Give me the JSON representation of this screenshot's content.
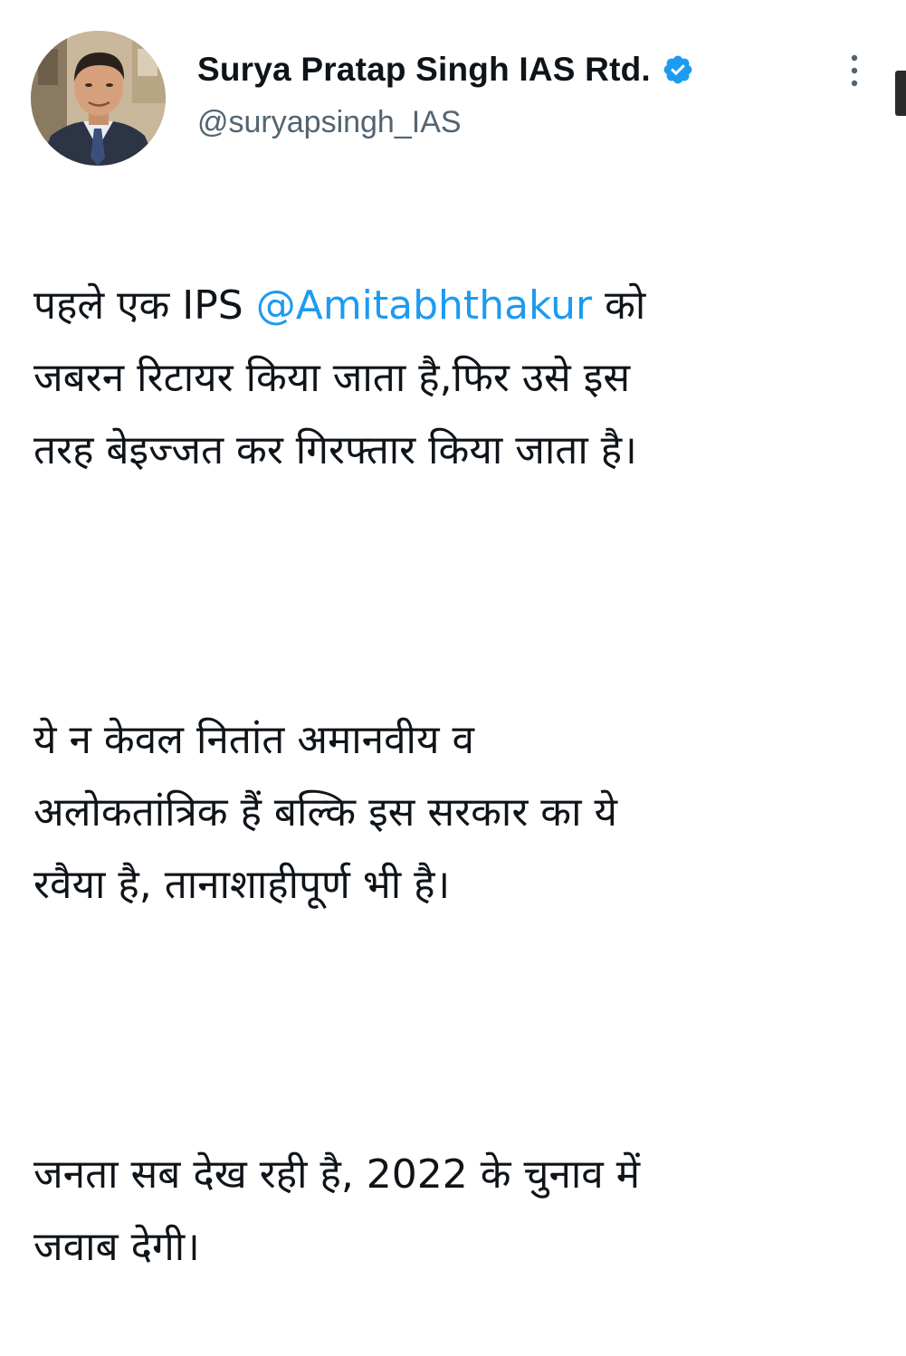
{
  "tweet": {
    "author": {
      "display_name": "Surya Pratap Singh IAS Rtd.",
      "handle": "@suryapsingh_IAS",
      "verified": true,
      "avatar_icon": "profile-photo"
    },
    "more_icon": "more-vertical-icon",
    "body": {
      "para1_prefix": "पहले एक IPS ",
      "mention": "@Amitabhthakur",
      "para1_suffix": " को\nजबरन रिटायर किया जाता है,फिर उसे इस\nतरह बेइज्जत कर गिरफ्तार किया जाता है।",
      "para2": "ये न केवल नितांत अमानवीय व\nअलोकतांत्रिक हैं बल्कि इस सरकार का ये\nरवैया है, तानाशाहीपूर्ण भी है।",
      "para3": "जनता सब देख रही है, 2022 के चुनाव में\nजवाब देगी।"
    },
    "colors": {
      "link": "#1d9bf0",
      "text": "#0f1419",
      "secondary": "#536471",
      "verified_badge": "#1d9bf0"
    }
  }
}
